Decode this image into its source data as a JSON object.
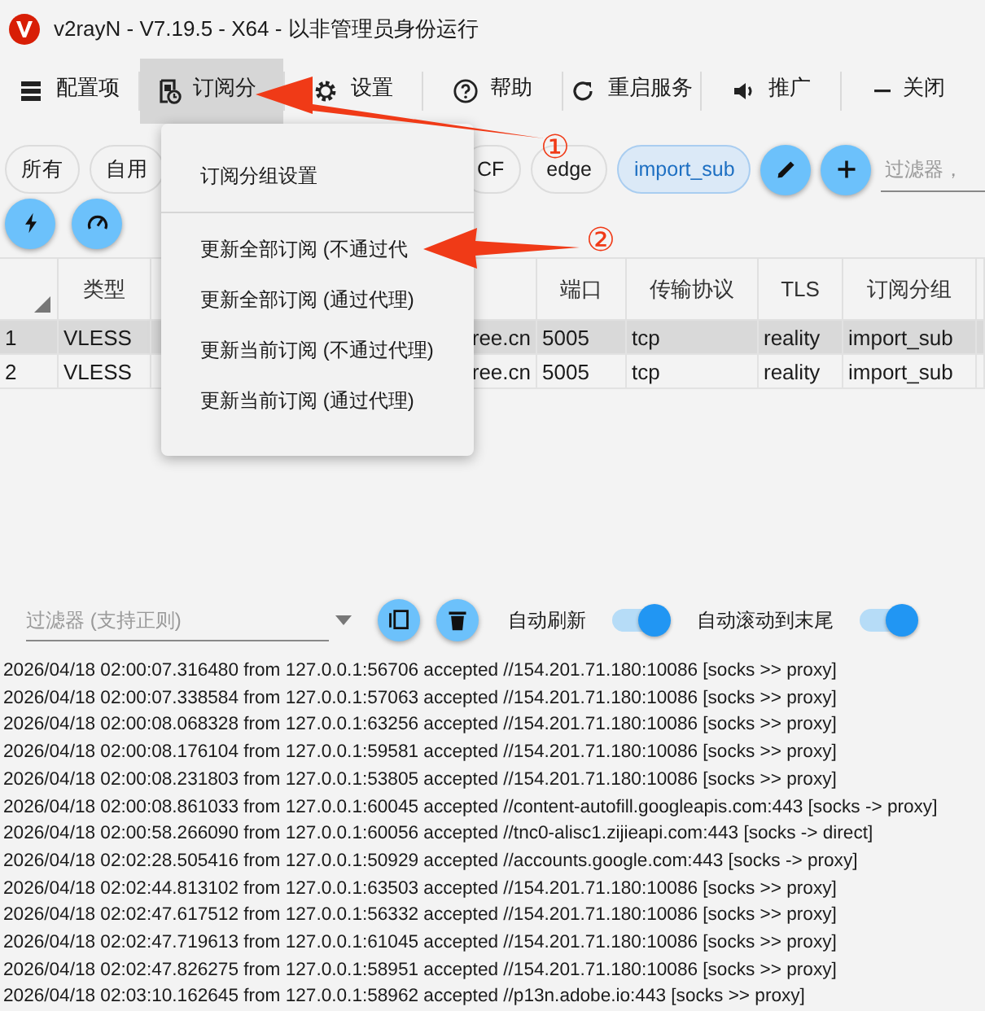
{
  "window": {
    "title": "v2rayN - V7.19.5 - X64 - 以非管理员身份运行"
  },
  "toolbar": [
    {
      "label": "配置项",
      "kind": "server",
      "selected": false
    },
    {
      "label": "订阅分",
      "kind": "subscription",
      "selected": true
    },
    {
      "label": "设置",
      "kind": "gear",
      "selected": false
    },
    {
      "label": "帮助",
      "kind": "help",
      "selected": false
    },
    {
      "label": "重启服务",
      "kind": "restart",
      "selected": false
    },
    {
      "label": "推广",
      "kind": "speaker",
      "selected": false
    },
    {
      "label": "关闭",
      "kind": "minus",
      "selected": false
    }
  ],
  "groups": {
    "tabs": [
      {
        "label": "所有",
        "selected": false
      },
      {
        "label": "自用",
        "selected": false
      },
      {
        "label": "CF",
        "selected": false
      },
      {
        "label": "edge",
        "selected": false
      },
      {
        "label": "import_sub",
        "selected": true
      }
    ],
    "filter_placeholder": "过滤器，"
  },
  "table": {
    "columns": [
      "",
      "类型",
      "",
      "端口",
      "传输协议",
      "TLS",
      "订阅分组"
    ],
    "rows": [
      {
        "selected": true,
        "cells": [
          "1",
          "VLESS",
          "ree.cn",
          "5005",
          "tcp",
          "reality",
          "import_sub"
        ]
      },
      {
        "selected": false,
        "cells": [
          "2",
          "VLESS",
          "ree.cn",
          "5005",
          "tcp",
          "reality",
          "import_sub"
        ]
      }
    ]
  },
  "menu": {
    "items": [
      {
        "kind": "item",
        "label": "订阅分组设置"
      },
      {
        "kind": "divider"
      },
      {
        "kind": "item",
        "label": "更新全部订阅 (不通过代"
      },
      {
        "kind": "item",
        "label": "更新全部订阅 (通过代理)"
      },
      {
        "kind": "item",
        "label": "更新当前订阅 (不通过代理)"
      },
      {
        "kind": "item",
        "label": "更新当前订阅 (通过代理)"
      }
    ]
  },
  "annotations": [
    {
      "label": "①"
    },
    {
      "label": "②"
    }
  ],
  "log": {
    "filter_placeholder": "过滤器 (支持正则)",
    "toggles": [
      {
        "label": "自动刷新",
        "on": true
      },
      {
        "label": "自动滚动到末尾",
        "on": true
      }
    ],
    "lines": [
      "2026/04/18 02:00:07.316480 from 127.0.0.1:56706 accepted //154.201.71.180:10086 [socks >> proxy]",
      "2026/04/18 02:00:07.338584 from 127.0.0.1:57063 accepted //154.201.71.180:10086 [socks >> proxy]",
      "2026/04/18 02:00:08.068328 from 127.0.0.1:63256 accepted //154.201.71.180:10086 [socks >> proxy]",
      "2026/04/18 02:00:08.176104 from 127.0.0.1:59581 accepted //154.201.71.180:10086 [socks >> proxy]",
      "2026/04/18 02:00:08.231803 from 127.0.0.1:53805 accepted //154.201.71.180:10086 [socks >> proxy]",
      "2026/04/18 02:00:08.861033 from 127.0.0.1:60045 accepted //content-autofill.googleapis.com:443 [socks -> proxy]",
      "2026/04/18 02:00:58.266090 from 127.0.0.1:60056 accepted //tnc0-alisc1.zijieapi.com:443 [socks -> direct]",
      "2026/04/18 02:02:28.505416 from 127.0.0.1:50929 accepted //accounts.google.com:443 [socks -> proxy]",
      "2026/04/18 02:02:44.813102 from 127.0.0.1:63503 accepted //154.201.71.180:10086 [socks >> proxy]",
      "2026/04/18 02:02:47.617512 from 127.0.0.1:56332 accepted //154.201.71.180:10086 [socks >> proxy]",
      "2026/04/18 02:02:47.719613 from 127.0.0.1:61045 accepted //154.201.71.180:10086 [socks >> proxy]",
      "2026/04/18 02:02:47.826275 from 127.0.0.1:58951 accepted //154.201.71.180:10086 [socks >> proxy]",
      "2026/04/18 02:03:10.162645 from 127.0.0.1:58962 accepted //p13n.adobe.io:443 [socks >> proxy]"
    ]
  }
}
